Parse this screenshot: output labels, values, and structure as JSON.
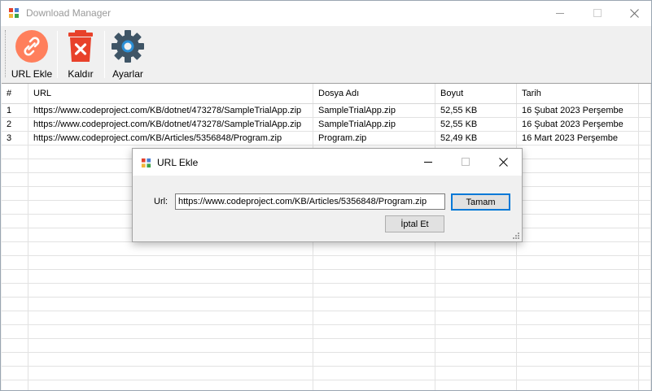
{
  "window": {
    "title": "Download Manager"
  },
  "toolbar": {
    "buttons": [
      {
        "label": "URL Ekle",
        "icon": "link-icon",
        "color": "#ff7f5c"
      },
      {
        "label": "Kaldır",
        "icon": "delete-icon",
        "color": "#e8412a"
      },
      {
        "label": "Ayarlar",
        "icon": "gear-icon",
        "color": "#3f5566"
      }
    ]
  },
  "grid": {
    "columns": [
      "#",
      "URL",
      "Dosya Adı",
      "Boyut",
      "Tarih"
    ],
    "rows": [
      {
        "index": "1",
        "url": "https://www.codeproject.com/KB/dotnet/473278/SampleTrialApp.zip",
        "file": "SampleTrialApp.zip",
        "size": "52,55 KB",
        "date": "16 Şubat 2023 Perşembe"
      },
      {
        "index": "2",
        "url": "https://www.codeproject.com/KB/dotnet/473278/SampleTrialApp.zip",
        "file": "SampleTrialApp.zip",
        "size": "52,55 KB",
        "date": "16 Şubat 2023 Perşembe"
      },
      {
        "index": "3",
        "url": "https://www.codeproject.com/KB/Articles/5356848/Program.zip",
        "file": "Program.zip",
        "size": "52,49 KB",
        "date": "16 Mart 2023 Perşembe"
      }
    ]
  },
  "dialog": {
    "title": "URL Ekle",
    "url_label": "Url:",
    "url_value": "https://www.codeproject.com/KB/Articles/5356848/Program.zip",
    "ok_label": "Tamam",
    "cancel_label": "İptal Et"
  },
  "colors": {
    "accent": "#0078d7",
    "link_button": "#ff7f5c",
    "delete_button": "#e8412a",
    "gear": "#3f5566"
  }
}
